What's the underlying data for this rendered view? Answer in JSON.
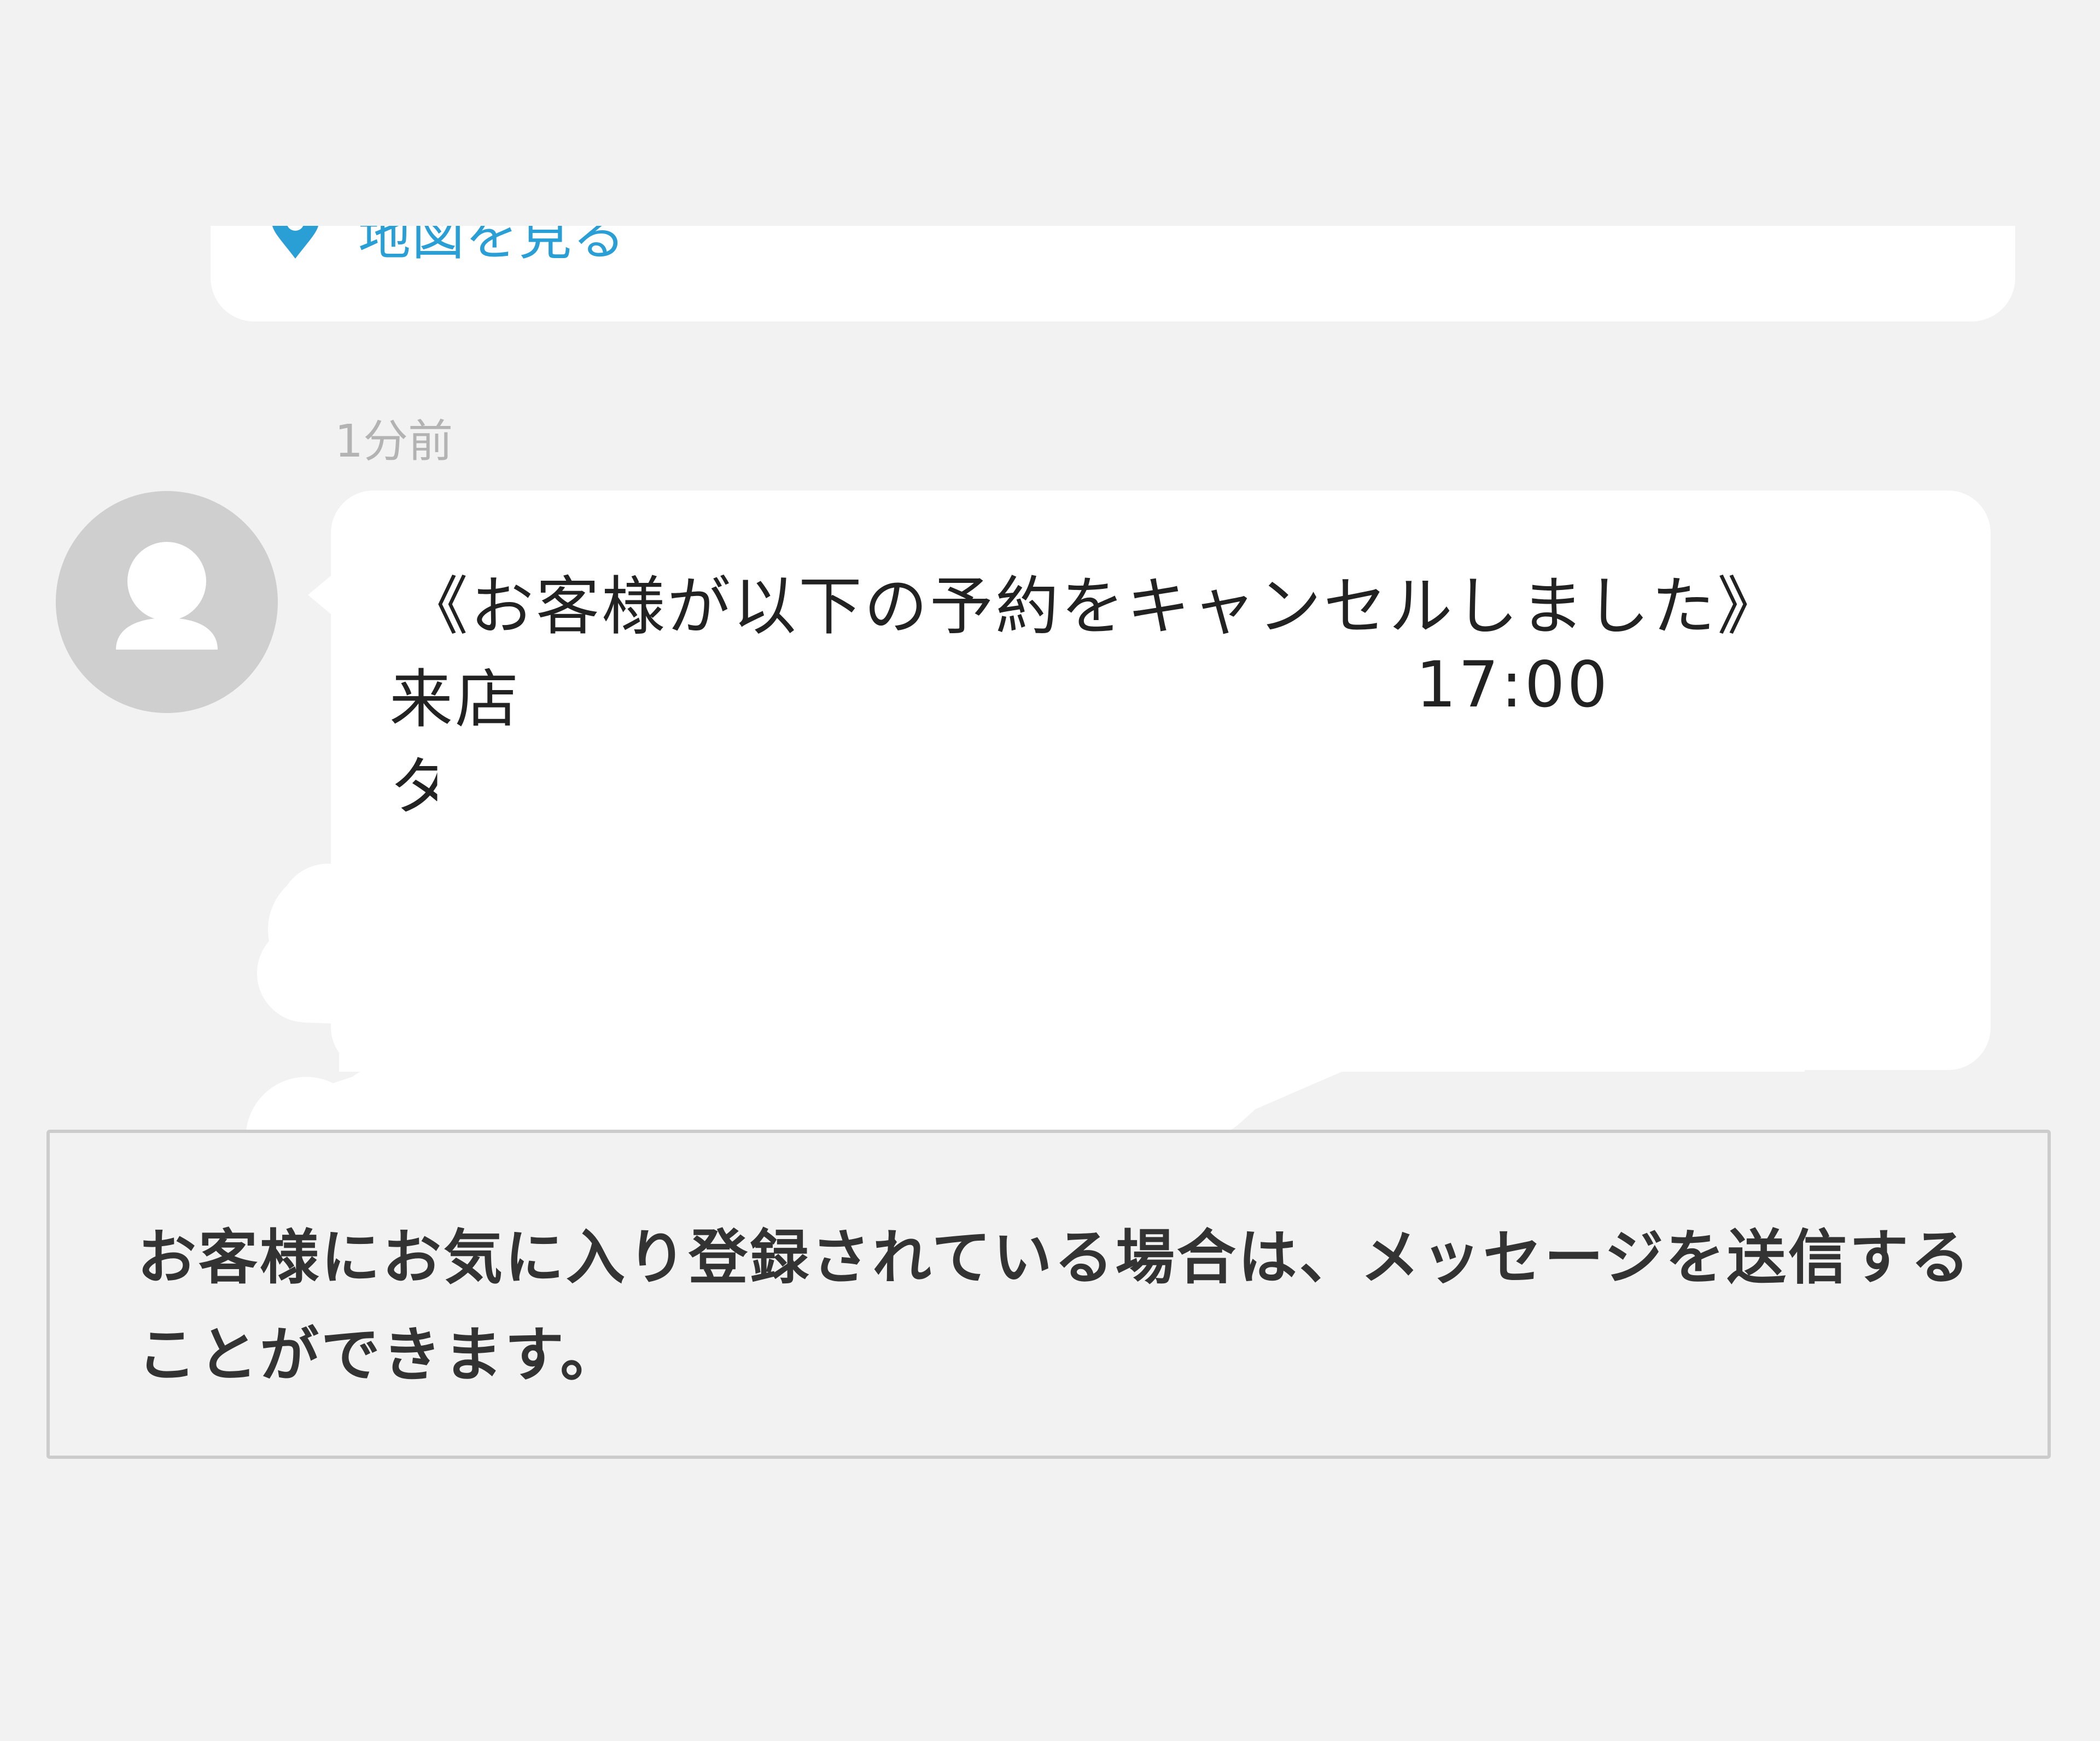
{
  "map_card": {
    "link_label": "地図を見る",
    "icon": "map-pin-icon"
  },
  "message": {
    "timestamp": "1分前",
    "avatar_icon": "user-avatar-icon",
    "line1": "《お客様が以下の予約をキャンセルしました》",
    "line2_visible": "来店",
    "line2_time": "17:00",
    "line3_visible": "タ"
  },
  "notice": {
    "text": "お客様にお気に入り登録されている場合は、メッセージを送信することができます。"
  },
  "colors": {
    "background": "#f2f2f2",
    "card": "#ffffff",
    "link": "#2a9fd6",
    "timestamp": "#b3b3b3",
    "avatar": "#cfcfcf",
    "notice_border": "#cccccc"
  }
}
